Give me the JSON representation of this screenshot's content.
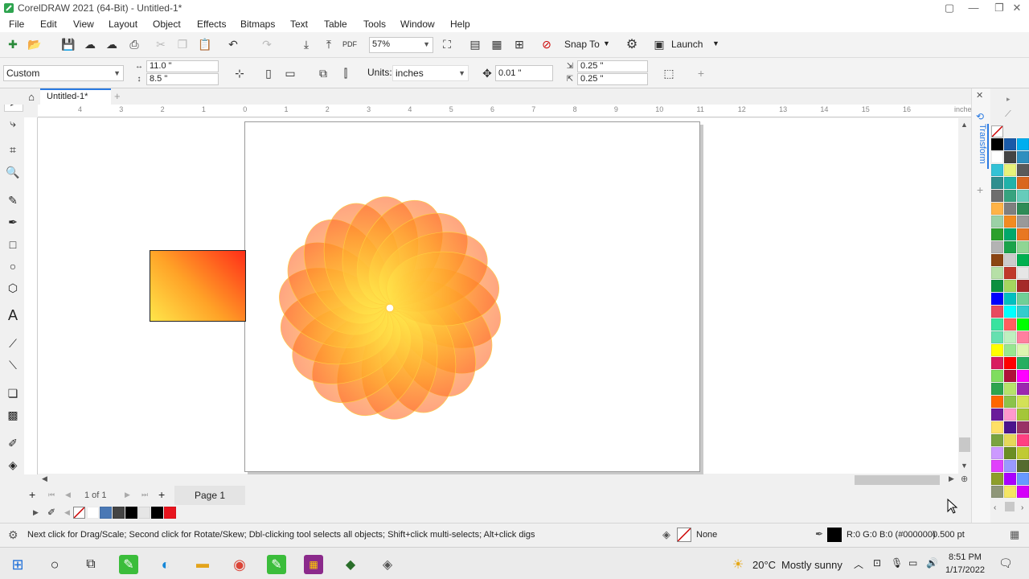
{
  "window": {
    "title": "CorelDRAW 2021 (64-Bit) - Untitled-1*"
  },
  "menu": [
    "File",
    "Edit",
    "View",
    "Layout",
    "Object",
    "Effects",
    "Bitmaps",
    "Text",
    "Table",
    "Tools",
    "Window",
    "Help"
  ],
  "standard_toolbar": {
    "zoom": "57%",
    "snap_to": "Snap To",
    "launch": "Launch"
  },
  "property_bar": {
    "page_size": "Custom",
    "width": "11.0 \"",
    "height": "8.5 \"",
    "units_label": "Units:",
    "units_value": "inches",
    "nudge": "0.01 \"",
    "dup_x": "0.25 \"",
    "dup_y": "0.25 \""
  },
  "tabs": [
    {
      "label": "Untitled-1*"
    }
  ],
  "ruler": {
    "unit_label": "inches",
    "h_ticks": [
      "4",
      "3",
      "2",
      "1",
      "0",
      "1",
      "2",
      "3",
      "4",
      "5",
      "6",
      "7",
      "8",
      "9",
      "10",
      "11",
      "12",
      "13",
      "14",
      "15",
      "16"
    ]
  },
  "page_nav": {
    "counter": "1 of 1",
    "page_tab": "Page 1"
  },
  "docker": {
    "title": "Transform"
  },
  "status": {
    "hint": "Next click for Drag/Scale; Second click for Rotate/Skew; Dbl-clicking tool selects all objects; Shift+click multi-selects; Alt+click digs",
    "fill": "None",
    "outline_color": "R:0 G:0 B:0 (#000000)",
    "outline_width": "0.500 pt"
  },
  "taskbar": {
    "weather_temp": "20°C",
    "weather_desc": "Mostly sunny",
    "time": "8:51 PM",
    "date": "1/17/2022"
  },
  "colors": {
    "gradient_start": "#ffe64a",
    "gradient_mid": "#ffa227",
    "gradient_end": "#ff2e18",
    "palette": [
      "#000000",
      "#1a5aa8",
      "#00aeef",
      "#ffffff",
      "#444444",
      "#2e8fbf",
      "#33c2d6",
      "#e8f27a",
      "#5a5a5a",
      "#2f8f8f",
      "#20b2aa",
      "#d9661f",
      "#6e6e6e",
      "#37a37f",
      "#66ccbb",
      "#ffb347",
      "#7f7f7f",
      "#2e8b57",
      "#9bd1a6",
      "#f28b20",
      "#999999",
      "#2ca02c",
      "#00a86b",
      "#e87722",
      "#b3b3b3",
      "#1aa34a",
      "#8fd694",
      "#8b4513",
      "#cccccc",
      "#00b050",
      "#b6e0a7",
      "#c0392b",
      "#e6e6e6",
      "#0b8f3f",
      "#a4d65e",
      "#a52a2a",
      "#0000ff",
      "#00c0c0",
      "#6fcf97",
      "#e84a5f",
      "#00ffff",
      "#33cccc",
      "#39e39f",
      "#ff5e5e",
      "#00ff00",
      "#66e0b0",
      "#bff0bf",
      "#ff7f9f",
      "#ffff00",
      "#98e690",
      "#def5b0",
      "#d81b60",
      "#ff0000",
      "#27ae60",
      "#7fdd5f",
      "#b0103a",
      "#ff00ff",
      "#2da44e",
      "#b7e36a",
      "#9c27b0",
      "#ff6600",
      "#8bc34a",
      "#d4e157",
      "#6a1b9a",
      "#ff99cc",
      "#a4c639",
      "#ffe066",
      "#4a148c",
      "#993366",
      "#79a33f",
      "#e6d85a",
      "#ff4081",
      "#cc99ff",
      "#6b8e23",
      "#c0ca33",
      "#e040fb",
      "#9999ff",
      "#556b2f",
      "#8d9e2a",
      "#aa00ff",
      "#6699ff",
      "#8f9779",
      "#f5e663",
      "#d500f9",
      "#3366cc",
      "#a0a060",
      "#fff59d",
      "#ea80fc",
      "#7777dd",
      "#9e9d24",
      "#ffff8d",
      "#cc66ff",
      "#5050c0",
      "#b0a030",
      "#fffde7",
      "#ff80ab",
      "#333399",
      "#d2b48c",
      "#f7e27a",
      "#f06292"
    ],
    "doc_palette": [
      "#ffffff",
      "#4a78b5",
      "#444444",
      "#000000",
      "#e6e6e6",
      "#000000",
      "#e8141e"
    ]
  }
}
